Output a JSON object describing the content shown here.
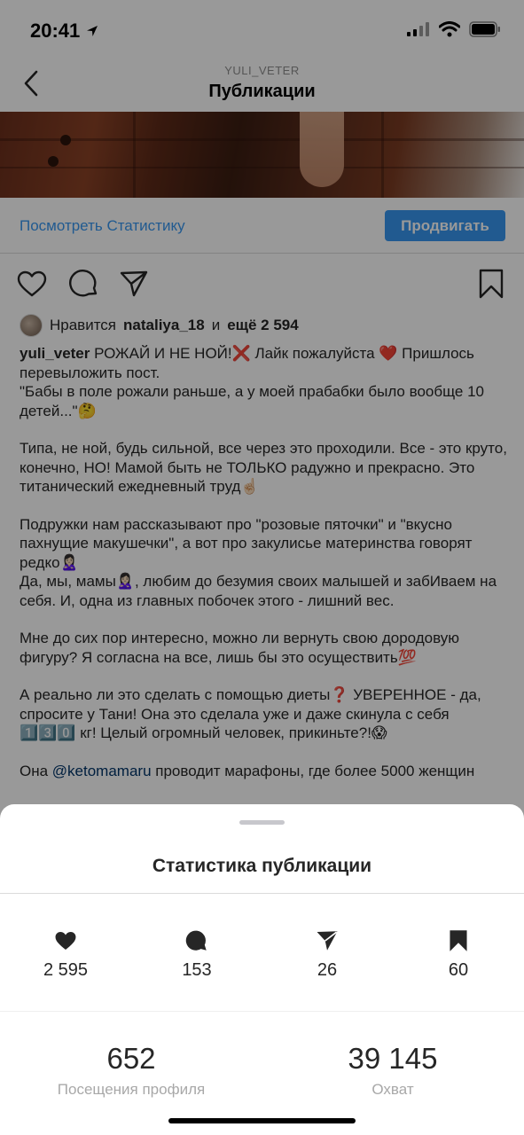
{
  "status_bar": {
    "time": "20:41"
  },
  "header": {
    "username": "YULI_VETER",
    "title": "Публикации"
  },
  "insights_row": {
    "view_insights": "Посмотреть Статистику",
    "promote": "Продвигать"
  },
  "likes": {
    "prefix": "Нравится",
    "user": "nataliya_18",
    "and": "и",
    "others": "ещё 2 594"
  },
  "caption": {
    "author": "yuli_veter",
    "line1": " РОЖАЙ И НЕ НОЙ!❌ Лайк пожалуйста ❤️ Пришлось перевыложить пост.",
    "line2": "\"Бабы в поле рожали раньше, а у моей прабабки было вообще 10 детей...\"🤔",
    "para2": "Типа, не ной, будь сильной, все через это проходили. Все - это круто, конечно, НО! Мамой быть не ТОЛЬКО радужно и прекрасно. Это титанический ежедневный труд☝🏻",
    "para3a": "Подружки нам рассказывают про \"розовые пяточки\" и \"вкусно пахнущие макушечки\", а вот про закулисье материнства говорят редко🙎🏻‍♀️",
    "para3b": "Да, мы, мамы🙎🏻‍♀️, любим до безумия своих малышей и забИваем на себя. И, одна из главных побочек этого - лишний вес.",
    "para4": "Мне до сих пор интересно, можно ли вернуть свою дородовую фигуру? Я согласна на все, лишь бы это осуществить💯",
    "para5": "А реально ли это сделать с помощью диеты❓ УВЕРЕННОЕ - да, спросите у Тани! Она это сделала уже и даже скинула с себя 1️⃣3️⃣0️⃣ кг! Целый огромный человек, прикиньте?!😱",
    "para6_prefix": "Она ",
    "para6_mention": "@ketomamaru",
    "para6_suffix": " проводит марафоны, где более 5000 женщин"
  },
  "sheet": {
    "title": "Статистика публикации",
    "stats": [
      {
        "icon": "heart-icon",
        "value": "2 595"
      },
      {
        "icon": "comment-icon",
        "value": "153"
      },
      {
        "icon": "send-icon",
        "value": "26"
      },
      {
        "icon": "bookmark-icon",
        "value": "60"
      }
    ],
    "profile_visits": {
      "value": "652",
      "label": "Посещения профиля"
    },
    "reach": {
      "value": "39 145",
      "label": "Охват"
    }
  },
  "colors": {
    "accent": "#3897f0",
    "text": "#262626",
    "muted": "#a8a8a8"
  }
}
